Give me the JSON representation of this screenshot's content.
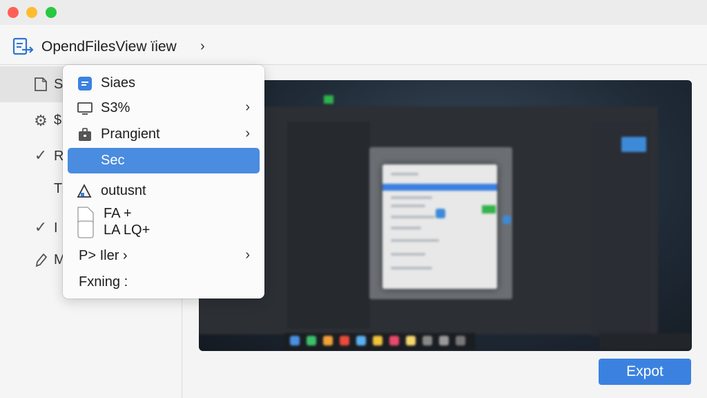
{
  "window": {
    "title": "OpendFilesView ïiew",
    "title_chevron": "›"
  },
  "colors": {
    "accent": "#3b82e0",
    "menu_highlight": "#4a8ce0",
    "close": "#ff5f57",
    "minimize": "#febc2e",
    "zoom": "#28c840"
  },
  "sidebar": {
    "items": [
      {
        "label": "S",
        "icon": "document-icon",
        "selected": true
      },
      {
        "label": "$",
        "icon": "gear-icon"
      },
      {
        "label": "R",
        "icon": "checkmark-icon"
      },
      {
        "label": "Tı",
        "icon": ""
      },
      {
        "label": "I",
        "icon": "checkmark-icon"
      },
      {
        "label": "M",
        "icon": "pen-icon"
      }
    ]
  },
  "context_menu": {
    "items": [
      {
        "label": "Siaes",
        "icon": "list-icon"
      },
      {
        "label": "S3%",
        "icon": "monitor-icon",
        "submenu": true
      },
      {
        "label": "Prangient",
        "icon": "briefcase-icon",
        "submenu": true
      },
      {
        "label": "Sec",
        "active": true
      },
      {
        "label": "outusnt",
        "icon": "warning-icon"
      },
      {
        "label_line1": "FA  +",
        "label_line2": "LA  LQ+",
        "icon": "stacked-pages-icon"
      },
      {
        "label": "P> Iler ›",
        "submenu": true
      },
      {
        "label": "Fxning :"
      }
    ]
  },
  "main": {
    "export_label": "Expot"
  }
}
